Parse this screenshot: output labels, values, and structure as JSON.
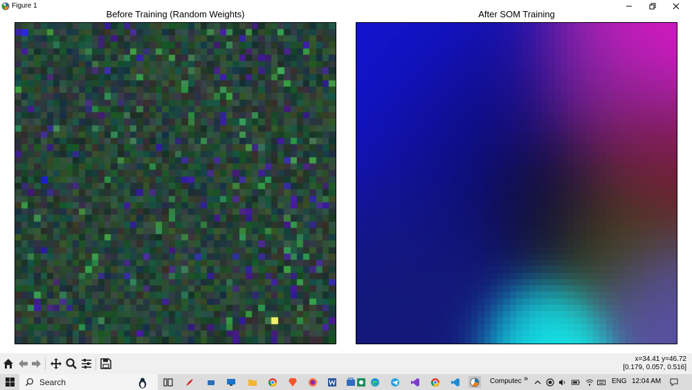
{
  "window": {
    "title": "Figure 1"
  },
  "figure": {
    "left_title": "Before Training (Random Weights)",
    "right_title": "After SOM Training"
  },
  "toolbar": {
    "coords_line1": "x=34.41 y=46.72",
    "coords_line2": "[0.179, 0.057, 0.516]",
    "buttons": [
      "home-icon",
      "back-icon",
      "forward-icon",
      "pan-icon",
      "zoom-icon",
      "configure-icon",
      "save-icon"
    ]
  },
  "taskbar": {
    "search_label": "Search",
    "running_label": "Computec",
    "language": "ENG",
    "time": "12:04 AM"
  },
  "colors": {
    "taskbar_bg": "#dcdcdc",
    "toolbar_bg": "#f0f0f0",
    "grid_base": "#24442f"
  }
}
